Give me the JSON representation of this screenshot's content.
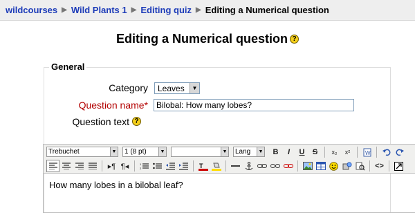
{
  "breadcrumb": {
    "items": [
      "wildcourses",
      "Wild Plants 1",
      "Editing quiz"
    ],
    "current": "Editing a Numerical question",
    "separator": "▶"
  },
  "page": {
    "title": "Editing a Numerical question",
    "help_icon": "?"
  },
  "form": {
    "legend": "General",
    "category": {
      "label": "Category",
      "value": "Leaves"
    },
    "question_name": {
      "label": "Question name*",
      "value": "Bilobal: How many lobes?"
    },
    "question_text": {
      "label": "Question text"
    }
  },
  "editor": {
    "font_family": "Trebuchet",
    "font_size": "1 (8 pt)",
    "format": "",
    "lang": "Lang",
    "content": "How many lobes in a bilobal leaf?",
    "buttons_row1": {
      "bold": "B",
      "italic": "I",
      "underline": "U",
      "strike": "S",
      "subscript": "x₂",
      "superscript": "x²"
    }
  },
  "colors": {
    "link": "#1c3bb8",
    "required": "#b30000",
    "help": "#f4cf1a"
  }
}
